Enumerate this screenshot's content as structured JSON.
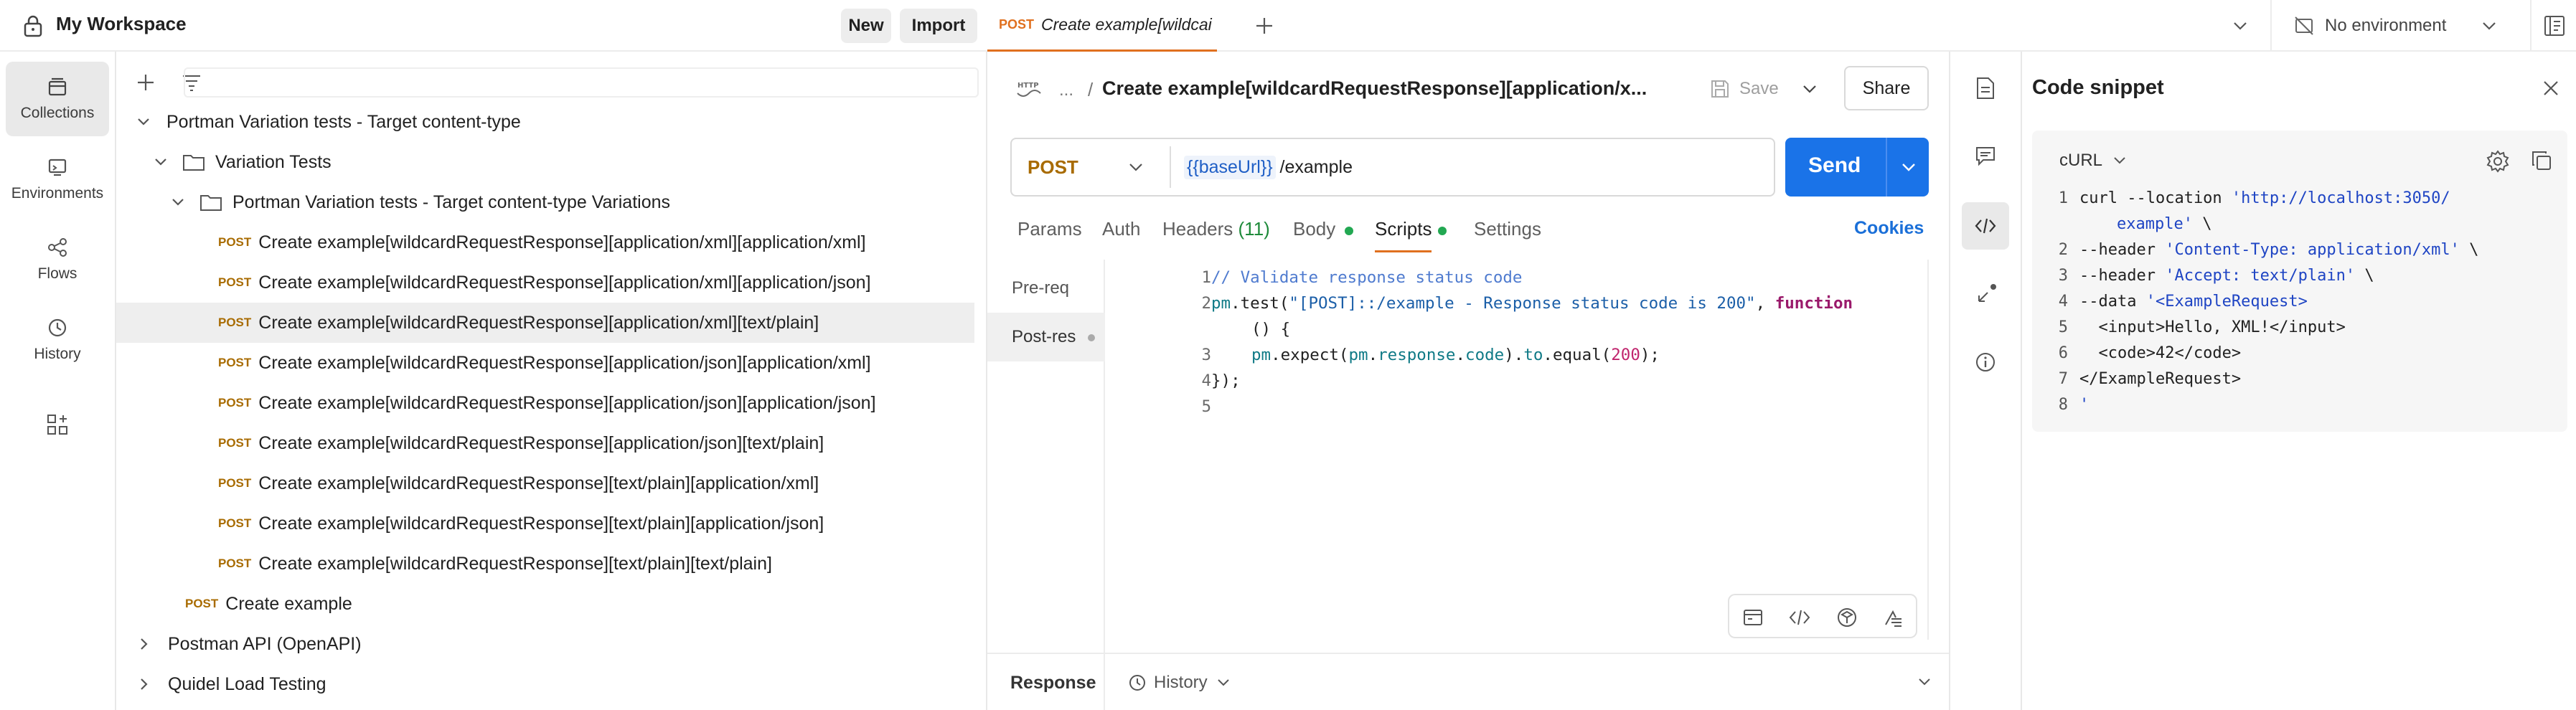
{
  "workspace": {
    "title": "My Workspace",
    "new_label": "New",
    "import_label": "Import"
  },
  "rail": [
    {
      "label": "Collections",
      "icon": "collections-icon"
    },
    {
      "label": "Environments",
      "icon": "environments-icon"
    },
    {
      "label": "Flows",
      "icon": "flows-icon"
    },
    {
      "label": "History",
      "icon": "history-icon"
    }
  ],
  "tree": {
    "root": "Portman Variation tests - Target content-type",
    "folder": "Variation Tests",
    "subfolder": "Portman Variation tests - Target content-type Variations",
    "method": "POST",
    "requests": [
      "Create example[wildcardRequestResponse][application/xml][application/xml]",
      "Create example[wildcardRequestResponse][application/xml][application/json]",
      "Create example[wildcardRequestResponse][application/xml][text/plain]",
      "Create example[wildcardRequestResponse][application/json][application/xml]",
      "Create example[wildcardRequestResponse][application/json][application/json]",
      "Create example[wildcardRequestResponse][application/json][text/plain]",
      "Create example[wildcardRequestResponse][text/plain][application/xml]",
      "Create example[wildcardRequestResponse][text/plain][application/json]",
      "Create example[wildcardRequestResponse][text/plain][text/plain]"
    ],
    "create_example": "Create example",
    "other_collections": [
      "Postman API (OpenAPI)",
      "Quidel Load Testing"
    ]
  },
  "tab": {
    "method": "POST",
    "title": "Create example[wildcai"
  },
  "environment": "No environment",
  "request": {
    "breadcrumb_ellipsis": "...",
    "name": "Create example[wildcardRequestResponse][application/x...",
    "save_label": "Save",
    "share_label": "Share",
    "method": "POST",
    "url_var": "{{baseUrl}}",
    "url_path": "/example",
    "send_label": "Send",
    "tabs": {
      "params": "Params",
      "auth": "Auth",
      "headers": "Headers",
      "headers_count": "(11)",
      "body": "Body",
      "scripts": "Scripts",
      "settings": "Settings"
    },
    "cookies": "Cookies",
    "pre_req": "Pre-req",
    "post_res": "Post-res",
    "code": {
      "l1": "// Validate response status code",
      "l2_a": "pm",
      "l2_b": ".test(",
      "l2_c": "\"[POST]::/example - Response status code is 200\"",
      "l2_d": ", ",
      "l2_e": "function",
      "l2w": "() {",
      "l3_a": "pm",
      "l3_b": ".expect(",
      "l3_c": "pm",
      "l3_d": ".",
      "l3_e": "response",
      "l3_f": ".",
      "l3_g": "code",
      "l3_h": ").",
      "l3_i": "to",
      "l3_j": ".equal(",
      "l3_k": "200",
      "l3_l": ");",
      "l4": "});"
    },
    "line_numbers": [
      "1",
      "2",
      "3",
      "4",
      "5"
    ],
    "response_label": "Response",
    "history_label": "History"
  },
  "snippet": {
    "title": "Code snippet",
    "language": "cURL",
    "line_numbers": [
      "1",
      "2",
      "3",
      "4",
      "5",
      "6",
      "7",
      "8"
    ],
    "l1_a": "curl --location ",
    "l1_b": "'http://localhost:3050/",
    "l1w": "example'",
    "l1w_b": " \\",
    "l2_a": "--header ",
    "l2_b": "'Content-Type: application/xml'",
    "l2_c": " \\",
    "l3_a": "--header ",
    "l3_b": "'Accept: text/plain'",
    "l3_c": " \\",
    "l4_a": "--data ",
    "l4_b": "'<ExampleRequest>",
    "l5": "  <input>Hello, XML!</input>",
    "l6": "  <code>42</code>",
    "l7": "</ExampleRequest>",
    "l8": "'"
  }
}
